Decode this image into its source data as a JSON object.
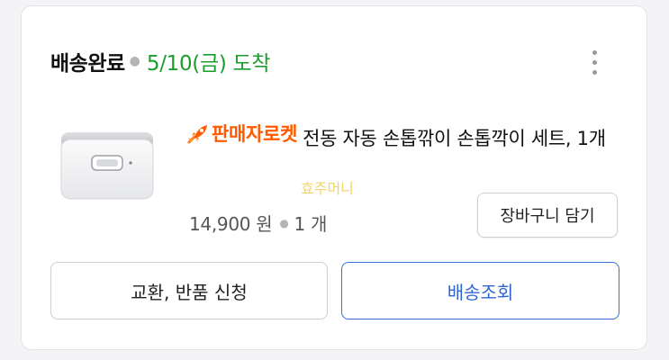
{
  "order": {
    "status": "배송완료",
    "arrival": "5/10(금) 도착"
  },
  "product": {
    "badge": "판매자로켓",
    "badge_icon": "rocket-icon",
    "name": "전동 자동 손톱깎이 손톱깍이 세트, 1개",
    "price": "14,900 원",
    "quantity": "1 개"
  },
  "watermark": "효주머니",
  "actions": {
    "cart": "장바구니 담기",
    "exchange": "교환, 반품 신청",
    "track": "배송조회"
  },
  "colors": {
    "arrival": "#1a9e2c",
    "badge": "#ff5a00",
    "track_border": "#3a6fd8"
  }
}
